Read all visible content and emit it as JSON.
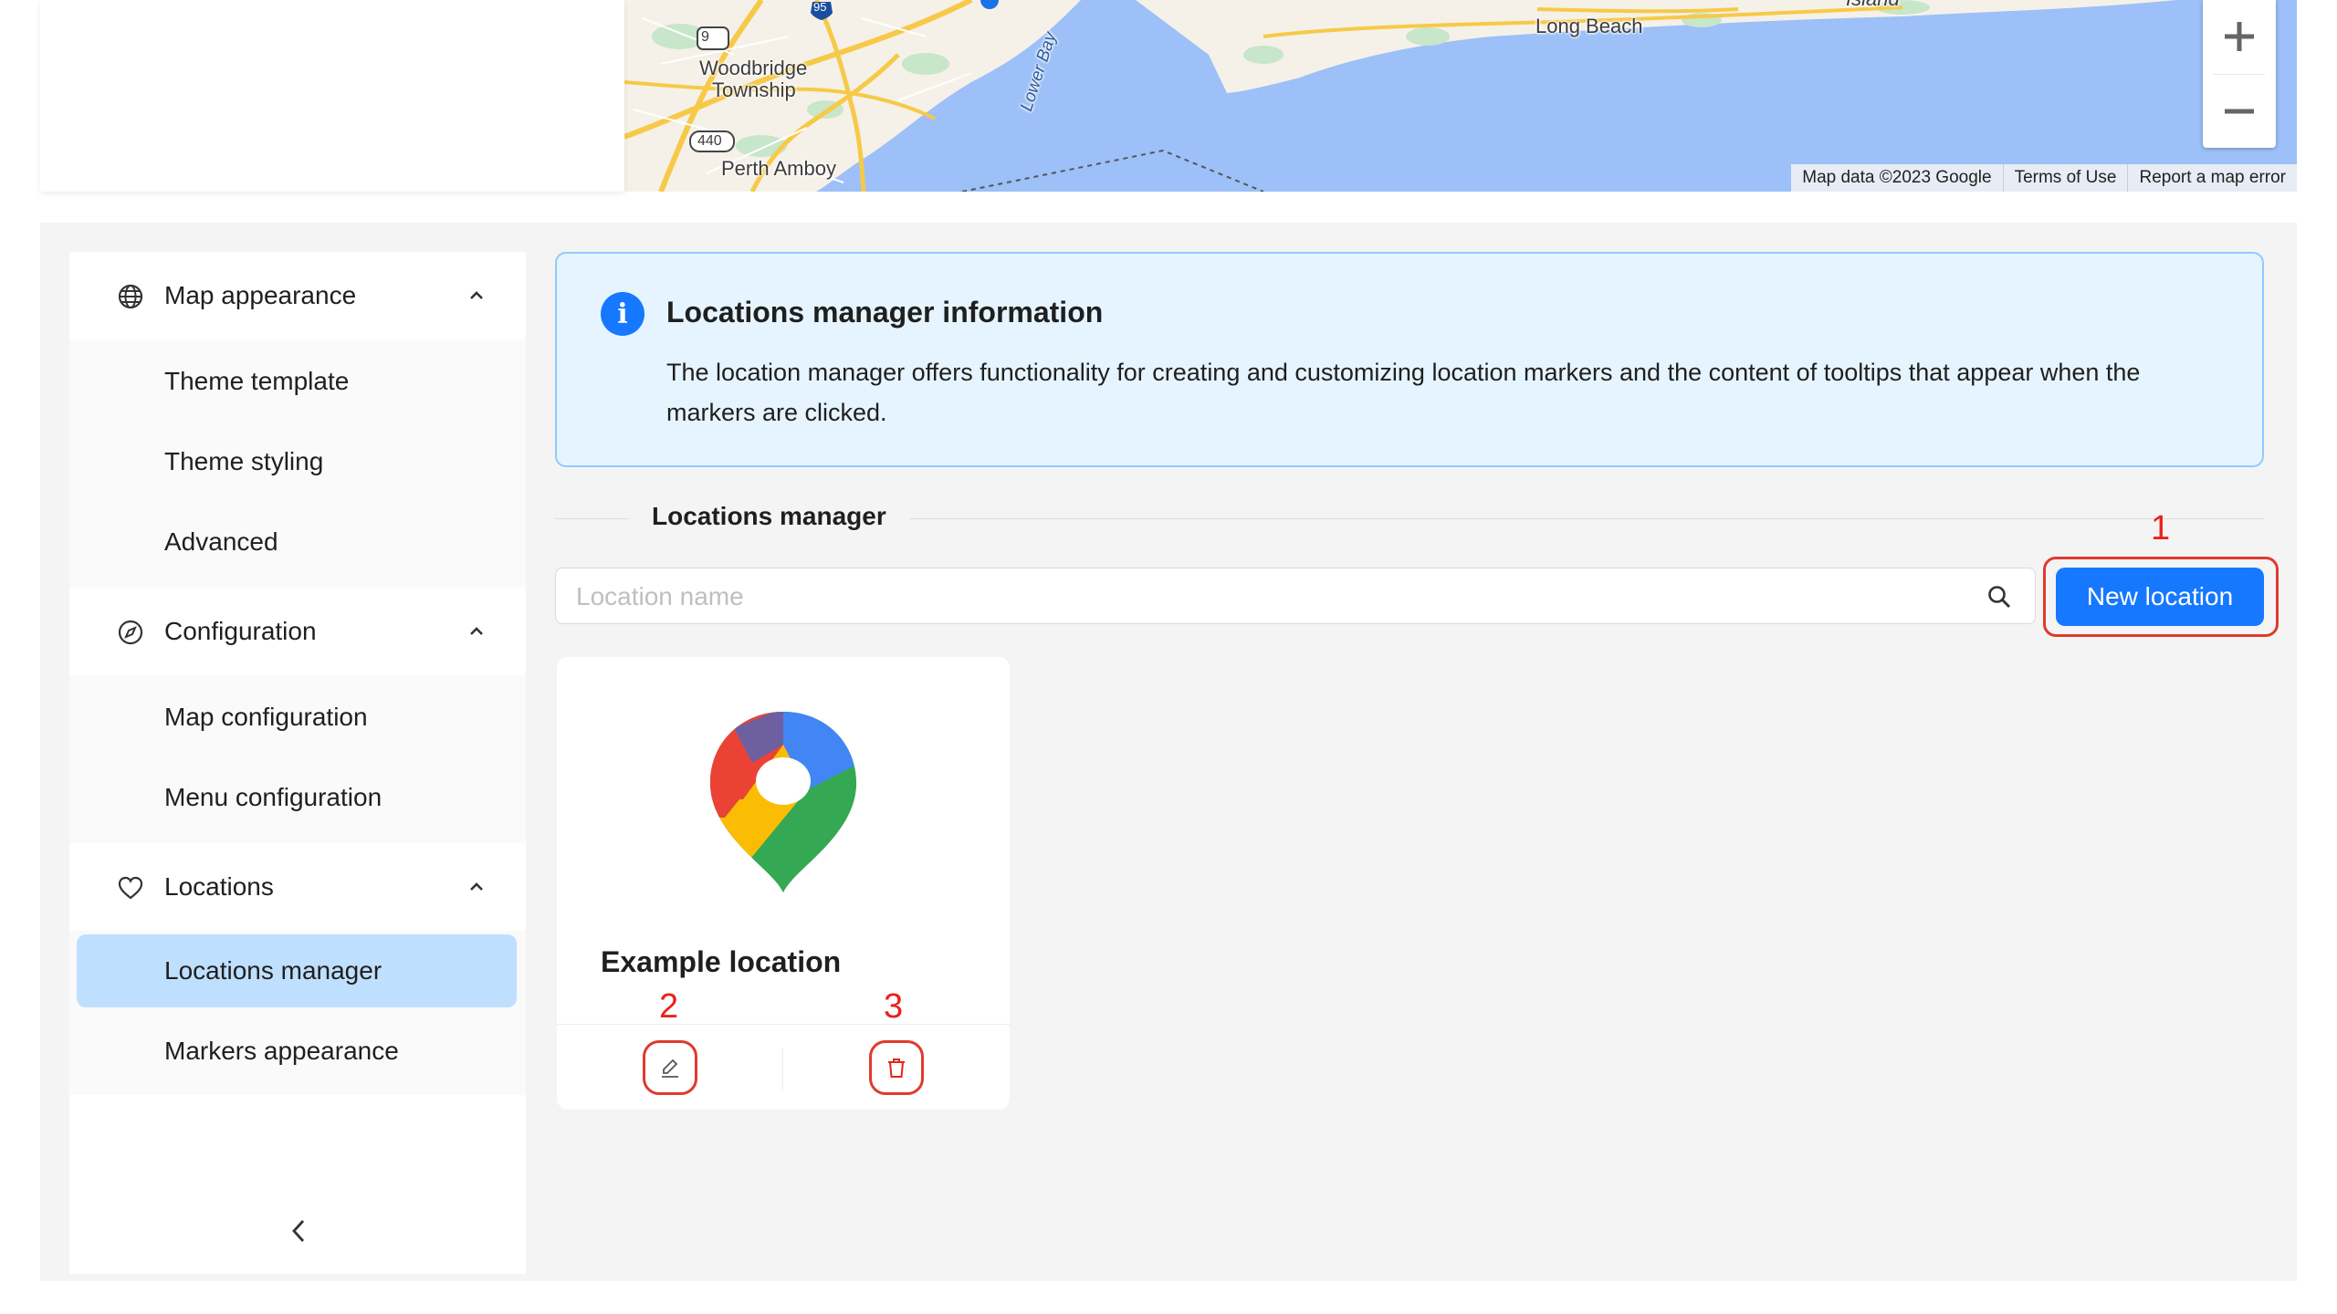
{
  "map": {
    "labels": {
      "woodbridge": "Woodbridge",
      "township": "Township",
      "perth_amboy": "Perth Amboy",
      "long_beach": "Long Beach",
      "lower_bay": "Lower Bay",
      "island": "Island",
      "shield_9": "9",
      "shield_95": "95",
      "shield_440": "440"
    },
    "attribution": {
      "map_data": "Map data ©2023 Google",
      "terms": "Terms of Use",
      "report": "Report a map error"
    }
  },
  "sidebar": {
    "groups": [
      {
        "label": "Map appearance",
        "icon": "globe-icon",
        "items": [
          "Theme template",
          "Theme styling",
          "Advanced"
        ]
      },
      {
        "label": "Configuration",
        "icon": "compass-icon",
        "items": [
          "Map configuration",
          "Menu configuration"
        ]
      },
      {
        "label": "Locations",
        "icon": "heart-icon",
        "items": [
          "Locations manager",
          "Markers appearance"
        ]
      }
    ],
    "active_item": "Locations manager"
  },
  "info": {
    "title": "Locations manager information",
    "text": "The location manager offers functionality for creating and customizing location markers and the content of tooltips that appear when the markers are clicked."
  },
  "section_title": "Locations manager",
  "search": {
    "placeholder": "Location name",
    "value": ""
  },
  "new_location_label": "New location",
  "locations": [
    {
      "name": "Example location",
      "icon": "google-maps-pin-icon"
    }
  ],
  "annotations": {
    "one": "1",
    "two": "2",
    "three": "3",
    "color": "#e8231a"
  },
  "colors": {
    "primary": "#1677ff",
    "active_bg": "#bfdfff",
    "info_bg": "#e6f4ff",
    "info_border": "#91caff",
    "water": "#9cc0f7"
  }
}
